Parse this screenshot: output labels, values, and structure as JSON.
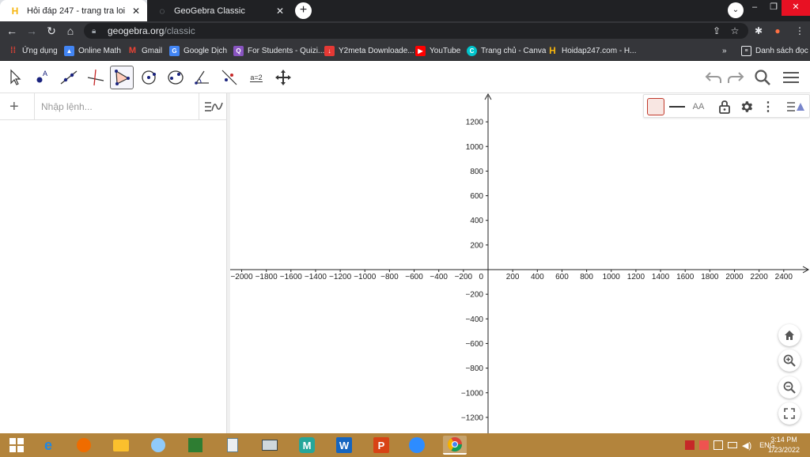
{
  "browser": {
    "tabs": [
      {
        "title": "Hỏi đáp 247 - trang tra loi",
        "active": true
      },
      {
        "title": "GeoGebra Classic",
        "active": false
      }
    ],
    "address": {
      "host": "geogebra.org",
      "path": "/classic"
    },
    "bookmarks": [
      {
        "label": "Ứng dụng",
        "icon": "apps-grid-icon",
        "color": "#ea4335"
      },
      {
        "label": "Online Math",
        "icon": "online-math-icon",
        "color": "#4285f4"
      },
      {
        "label": "Gmail",
        "icon": "gmail-icon",
        "color": "#ea4335"
      },
      {
        "label": "Google Dịch",
        "icon": "google-translate-icon",
        "color": "#4285f4"
      },
      {
        "label": "For Students - Quizi...",
        "icon": "quizizz-icon",
        "color": "#8854c0"
      },
      {
        "label": "Y2meta Downloade...",
        "icon": "y2meta-icon",
        "color": "#e53935"
      },
      {
        "label": "YouTube",
        "icon": "youtube-icon",
        "color": "#ff0000"
      },
      {
        "label": "Trang chủ - Canva",
        "icon": "canva-icon",
        "color": "#00c4cc"
      },
      {
        "label": "Hoidap247.com - H...",
        "icon": "hoidap247-icon",
        "color": "#f6b50e"
      }
    ],
    "more_bookmarks": "»",
    "reading_list": "Danh sách đọc"
  },
  "geogebra": {
    "input_placeholder": "Nhập lệnh...",
    "stylebar_text_icon": "AA",
    "tool_input_label": "a=2"
  },
  "graph": {
    "x_ticks": [
      -2000,
      -1800,
      -1600,
      -1400,
      -1200,
      -1000,
      -800,
      -600,
      -400,
      -200,
      200,
      400,
      600,
      800,
      1000,
      1200,
      1400,
      1600,
      1800,
      2000,
      2200,
      2400
    ],
    "y_ticks": [
      1200,
      1000,
      800,
      600,
      400,
      200,
      -200,
      -400,
      -600,
      -800,
      -1000,
      -1200
    ],
    "origin_label": "0"
  },
  "taskbar": {
    "language": "ENG",
    "time": "3:14 PM",
    "date": "1/23/2022"
  }
}
